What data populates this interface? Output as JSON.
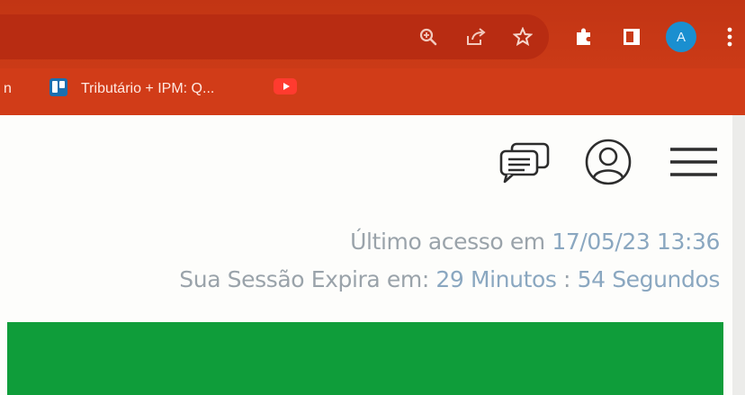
{
  "browser": {
    "toolbar": {
      "zoom_icon": "zoom-in-icon",
      "share_icon": "share-icon",
      "bookmark_icon": "star-icon",
      "extensions_icon": "puzzle-icon",
      "sidepanel_icon": "side-panel-icon",
      "profile_initial": "A",
      "menu_icon": "kebab-menu-icon"
    },
    "bookmarks": {
      "partial_left": "n",
      "trello_label": "Tributário + IPM: Q..."
    }
  },
  "page": {
    "header_icons": [
      "chat-icon",
      "user-icon",
      "hamburger-menu-icon"
    ],
    "last_access": {
      "label": "Último acesso em",
      "value": "17/05/23 13:36"
    },
    "session": {
      "label": "Sua Sessão Expira em:",
      "minutes": "29",
      "minutes_label": "Minutos",
      "separator": ":",
      "seconds": "54",
      "seconds_label": "Segundos"
    }
  },
  "colors": {
    "chrome": "#c93a17",
    "bookmarks_bar": "#d13c18",
    "avatar": "#1a8fd0",
    "banner": "#0f9d3a",
    "info_text": "#9aa3aa"
  }
}
